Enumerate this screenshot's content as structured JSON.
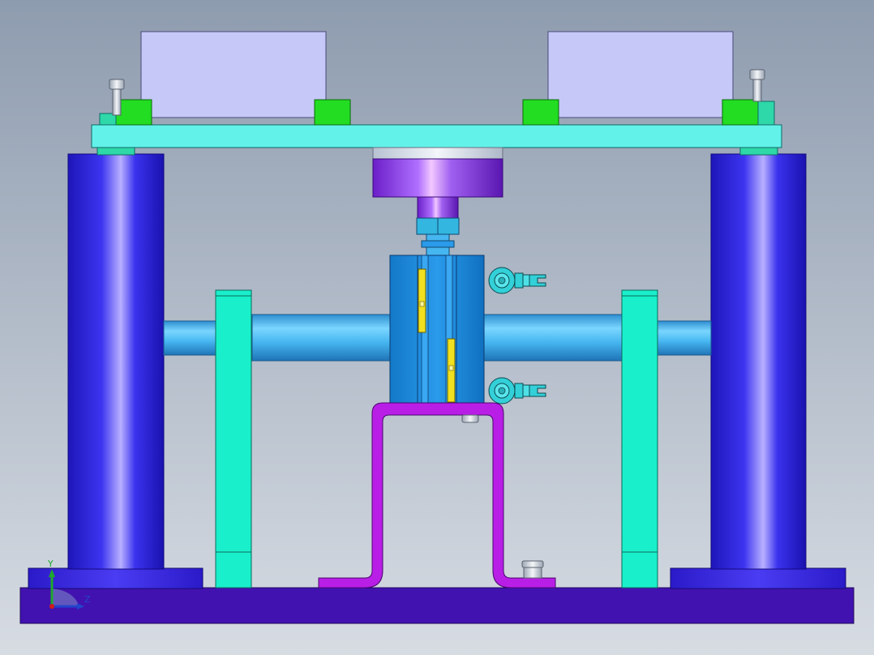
{
  "viewport": {
    "background_top": "#8E9CAF",
    "background_bottom": "#D7DCE3"
  },
  "triad": {
    "y_label": "Y",
    "z_label": "Z",
    "x_axis_color": "#D11A1A",
    "y_axis_color": "#1FA82E",
    "z_axis_color": "#2244CC"
  },
  "colors": {
    "base_plate": "#4212B0",
    "column": "#2B22D8",
    "column_highlight": "#B8B0FF",
    "top_plate": "#63F2EA",
    "block": "#C6C8F8",
    "green_pad": "#22DD22",
    "support_plate": "#19F0CB",
    "shaft": "#46B6F0",
    "cylinder_body": "#1A8DDF",
    "sensor_yellow": "#F0E020",
    "bracket_purple": "#B91EE6",
    "load_cell": "#9A3AE0",
    "fitting_cyan": "#33D0D8"
  }
}
